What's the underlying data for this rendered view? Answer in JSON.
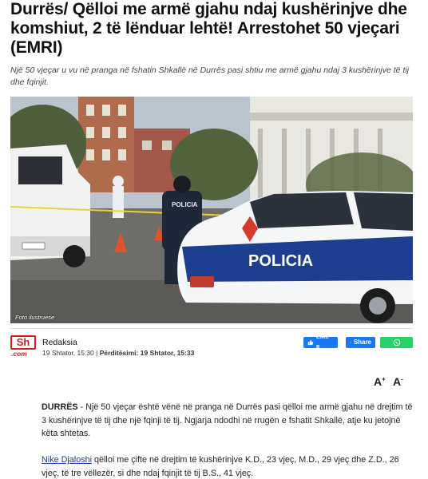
{
  "article": {
    "headline": "Durrës/ Qëlloi me armë gjahu ndaj kushërinjve dhe komshiut, 2 të lënduar lehtë! Arrestohet 50 vjeçari (EMRI)",
    "sublead": "Një 50 vjeçar u vu në pranga në fshatin Shkallë në Durrës pasi shtiu me armë gjahu ndaj 3 kushërinjve të tij dhe fqinjit.",
    "photo_caption": "Foto ilustruese",
    "photo_police_text_car": "POLICIA",
    "photo_police_text_vest": "POLICIA"
  },
  "byline": {
    "logo_main": "Sh",
    "logo_sub": ".com",
    "author": "Redaksia",
    "published": "19 Shtator, 15:30",
    "separator": "|",
    "updated_label": "Përditësimi:",
    "updated": "19 Shtator, 15:33"
  },
  "social": {
    "like_label": "Like 8",
    "share_label": "Share"
  },
  "font_controls": {
    "increase": "A",
    "increase_sup": "+",
    "decrease": "A",
    "decrease_sup": "-"
  },
  "body": {
    "p1_lead": "DURRËS",
    "p1_text": " - Një 50 vjeçar është vënë në pranga në Durrës pasi qëlloi me armë gjahu në drejtim të 3 kushërinjve të tij dhe një fqinji të tij. Ngjarja ndodhi në rrugën e fshatit Shkallë, atje ku jetojnë këta shtetas.",
    "p2_link": "Nike Djaloshi",
    "p2_text": " qëlloi me çifte në drejtim të kushërinjve K.D., 23 vjeç, M.D., 29 vjeç dhe Z.D., 26 vjeç, të tre vëllezër, si dhe ndaj fqinjit të tij B.S., 41 vjeç."
  },
  "colors": {
    "brand_red": "#d32020",
    "facebook_blue": "#1a77f2",
    "whatsapp_green": "#25d366",
    "link_blue": "#1b3b9a"
  }
}
